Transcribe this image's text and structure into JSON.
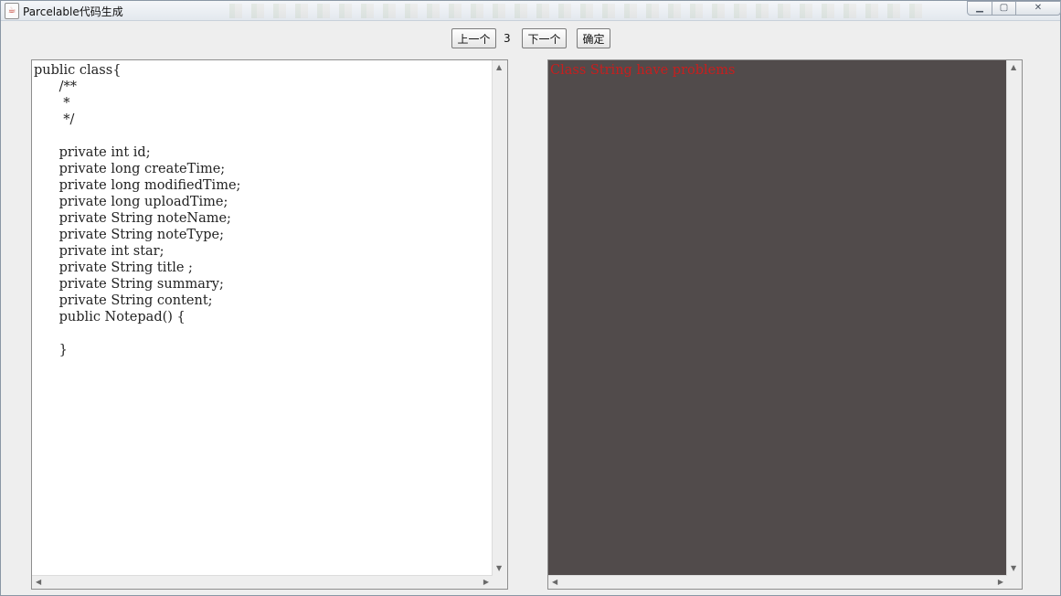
{
  "window": {
    "title": "Parcelable代码生成",
    "app_icon": "java-cup-icon",
    "controls": {
      "minimize": "minimize-icon",
      "maximize": "maximize-icon",
      "close": "close-icon"
    }
  },
  "toolbar": {
    "prev_label": "上一个",
    "page_number": "3",
    "next_label": "下一个",
    "confirm_label": "确定"
  },
  "left_editor": {
    "text": "public class{\n      /**\n       *\n       */\n\n      private int id;\n      private long createTime;\n      private long modifiedTime;\n      private long uploadTime;\n      private String noteName;\n      private String noteType;\n      private int star;\n      private String title ;\n      private String summary;\n      private String content;\n      public Notepad() {\n\n      }"
  },
  "right_output": {
    "text": "Class String have problems",
    "background": "#514b4b",
    "text_color": "#c81e1e"
  },
  "scrollbars": {
    "up": "▲",
    "down": "▼",
    "left": "◀",
    "right": "▶"
  }
}
